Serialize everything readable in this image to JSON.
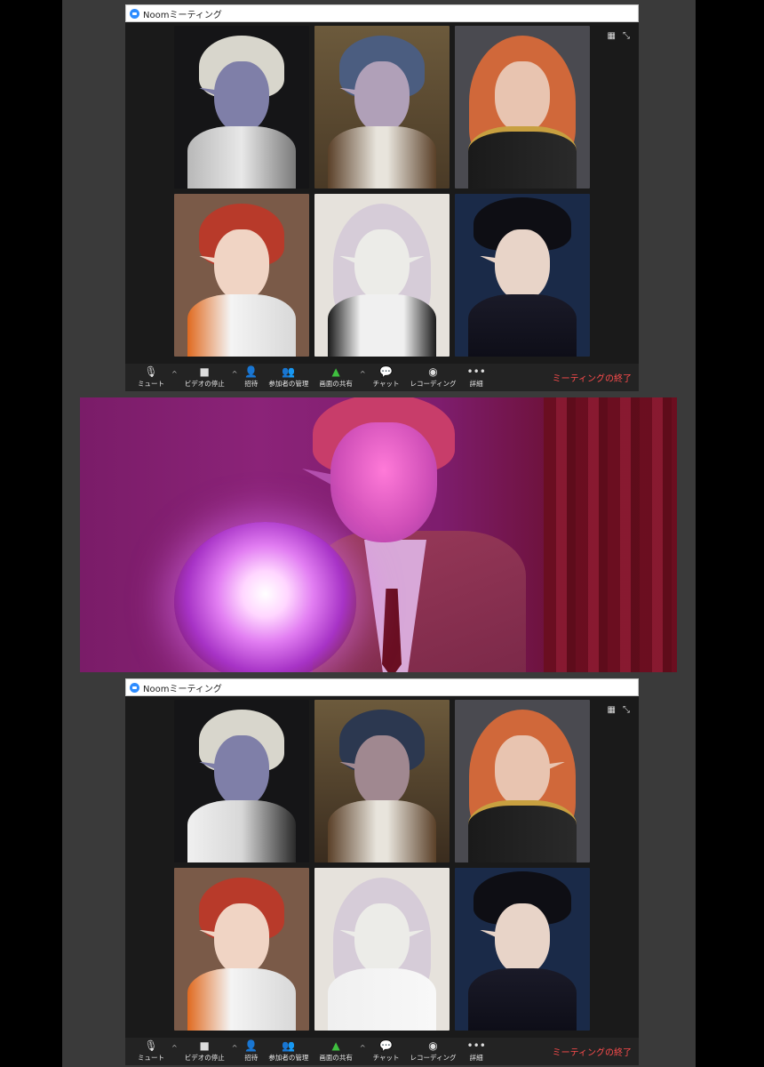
{
  "windows": [
    {
      "title": "Noomミーティング",
      "toolbar": {
        "mute_label": "ミュート",
        "video_label": "ビデオの停止",
        "invite_label": "招待",
        "participants_label": "参加者の管理",
        "share_label": "画面の共有",
        "chat_label": "チャット",
        "record_label": "レコーディング",
        "more_label": "詳細",
        "end_label": "ミーティングの終了"
      }
    },
    {
      "title": "Noomミーティング",
      "toolbar": {
        "mute_label": "ミュート",
        "video_label": "ビデオの停止",
        "invite_label": "招待",
        "participants_label": "参加者の管理",
        "share_label": "画面の共有",
        "chat_label": "チャット",
        "record_label": "レコーディング",
        "more_label": "詳細",
        "end_label": "ミーティングの終了"
      }
    }
  ],
  "colors": {
    "accent_share": "#3fbf3f",
    "end_meeting": "#ff4d4d",
    "toolbar_bg": "#232323"
  },
  "icons": [
    "zoom-logo-icon",
    "microphone-icon",
    "video-camera-icon",
    "invite-person-icon",
    "participants-icon",
    "share-screen-icon",
    "chat-bubble-icon",
    "record-icon",
    "more-dots-icon",
    "gallery-view-icon",
    "fullscreen-icon"
  ]
}
